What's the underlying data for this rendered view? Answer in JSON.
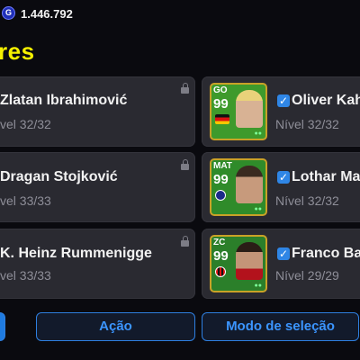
{
  "header": {
    "coin_icon_letter": "G",
    "coins": "1.446.792",
    "title": "res"
  },
  "left_cards": [
    {
      "name": "Zlatan Ibrahimović",
      "level": "vel 32/32"
    },
    {
      "name": "Dragan Stojković",
      "level": "vel 33/33"
    },
    {
      "name": "K. Heinz Rummenigge",
      "level": "vel 33/33"
    }
  ],
  "right_cards": [
    {
      "position": "GO",
      "rating": "99",
      "name": "Oliver Kah",
      "level": "Nível 32/32",
      "card_color": "#3e9a2c",
      "badge": "germany-flag"
    },
    {
      "position": "MAT",
      "rating": "99",
      "name": "Lothar Ma",
      "level": "Nível 32/32",
      "card_color": "#2f8b2a",
      "badge": "inter-badge"
    },
    {
      "position": "ZC",
      "rating": "99",
      "name": "Franco Ba",
      "level": "Nível 29/29",
      "card_color": "#2b7f2a",
      "badge": "milan-badge"
    }
  ],
  "bottom": {
    "action_label": "Ação",
    "select_label": "Modo de seleção"
  },
  "colors": {
    "accent": "#3b95ff",
    "title": "#f5f000",
    "card_bg": "#2a2a31"
  }
}
